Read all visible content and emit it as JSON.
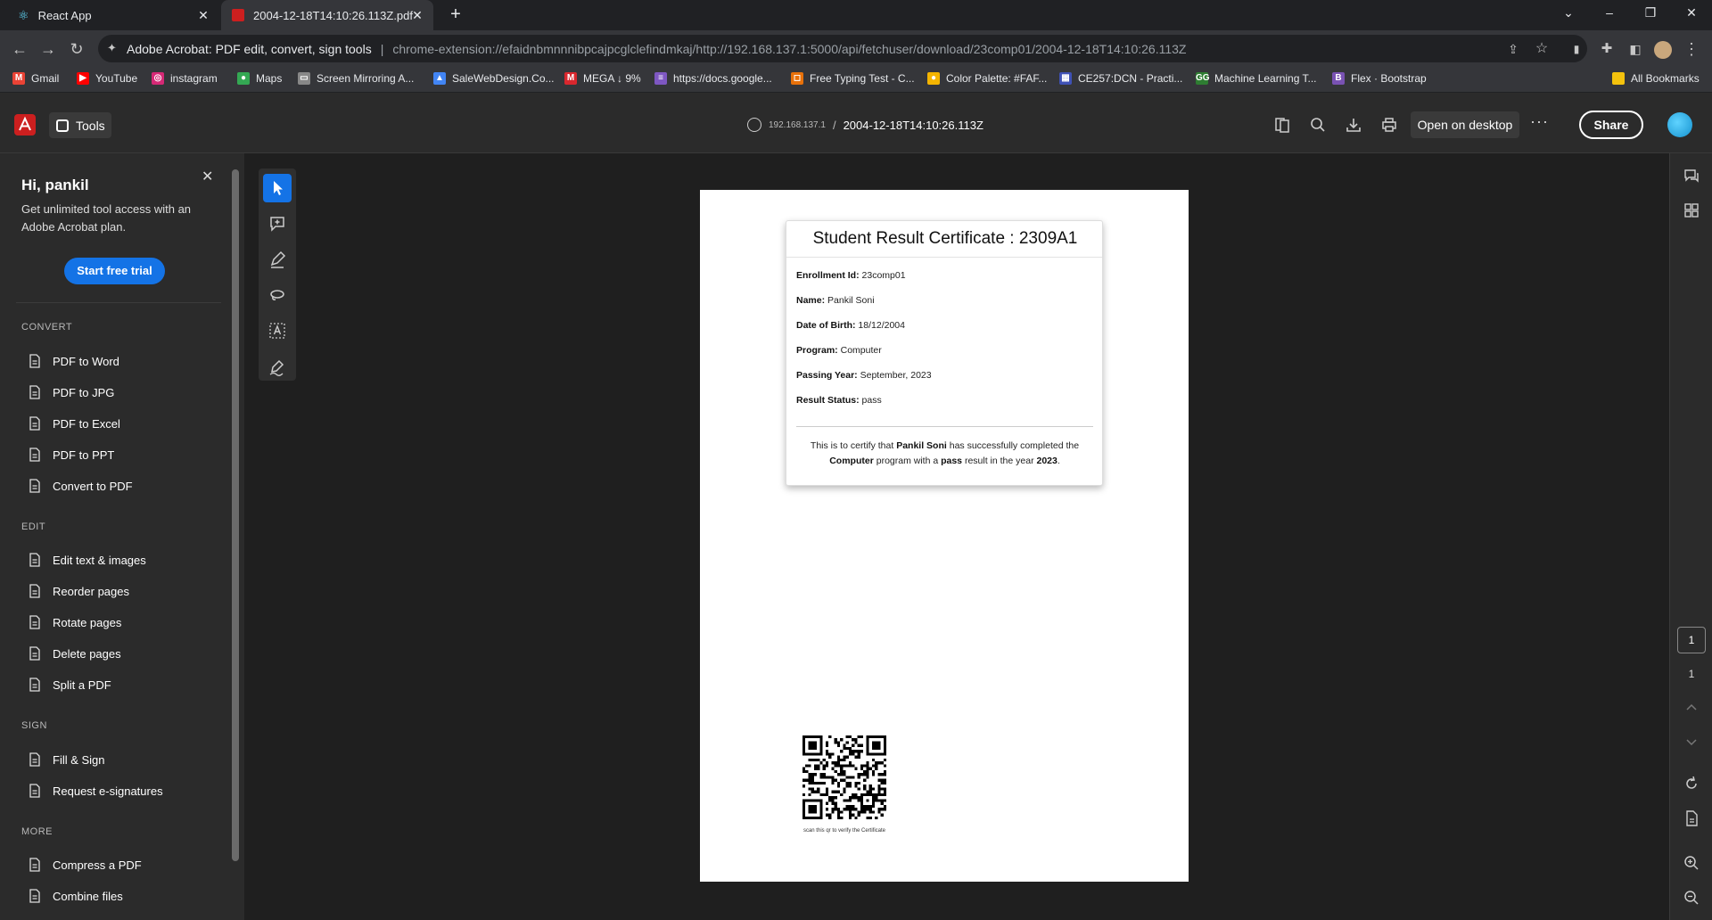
{
  "browser": {
    "tabs": [
      {
        "title": "React App",
        "icon": "react-icon"
      },
      {
        "title": "2004-12-18T14:10:26.113Z.pdf",
        "icon": "pdf-icon"
      }
    ],
    "omnibox": {
      "site_name": "Adobe Acrobat: PDF edit, convert, sign tools",
      "url": "chrome-extension://efaidnbmnnnibpcajpcglclefindmkaj/http://192.168.137.1:5000/api/fetchuser/download/23comp01/2004-12-18T14:10:26.113Z"
    },
    "bookmarks": [
      {
        "label": "Gmail",
        "color": "#ea4335",
        "glyph": "M"
      },
      {
        "label": "YouTube",
        "color": "#ff0000",
        "glyph": "▶"
      },
      {
        "label": "instagram",
        "color": "#d62976",
        "glyph": "◎"
      },
      {
        "label": "Maps",
        "color": "#34a853",
        "glyph": "●"
      },
      {
        "label": "Screen Mirroring A...",
        "color": "#888888",
        "glyph": "▭"
      },
      {
        "label": "SaleWebDesign.Co...",
        "color": "#4285f4",
        "glyph": "▲"
      },
      {
        "label": "MEGA ↓ 9%",
        "color": "#d9272e",
        "glyph": "M"
      },
      {
        "label": "https://docs.google...",
        "color": "#7e57c2",
        "glyph": "≡"
      },
      {
        "label": "Free Typing Test - C...",
        "color": "#e8710a",
        "glyph": "◻"
      },
      {
        "label": "Color Palette: #FAF...",
        "color": "#f4b400",
        "glyph": "●"
      },
      {
        "label": "CE257:DCN - Practi...",
        "color": "#3f51b5",
        "glyph": "▦"
      },
      {
        "label": "Machine Learning T...",
        "color": "#2e7d32",
        "glyph": "GG"
      },
      {
        "label": "Flex · Bootstrap",
        "color": "#7952b3",
        "glyph": "B"
      }
    ],
    "all_bookmarks": "All Bookmarks"
  },
  "acrobat": {
    "tools_label": "Tools",
    "host": "192.168.137.1",
    "filename": "2004-12-18T14:10:26.113Z",
    "open_desktop": "Open on desktop",
    "more": "···",
    "share": "Share"
  },
  "left_panel": {
    "greeting": "Hi, pankil",
    "subtitle": "Get unlimited tool access with an Adobe Acrobat plan.",
    "trial_button": "Start free trial",
    "sections": {
      "convert": "CONVERT",
      "edit": "EDIT",
      "sign": "SIGN",
      "more": "MORE"
    },
    "convert_items": [
      "PDF to Word",
      "PDF to JPG",
      "PDF to Excel",
      "PDF to PPT",
      "Convert to PDF"
    ],
    "edit_items": [
      "Edit text & images",
      "Reorder pages",
      "Rotate pages",
      "Delete pages",
      "Split a PDF"
    ],
    "sign_items": [
      "Fill & Sign",
      "Request e-signatures"
    ],
    "more_items": [
      "Compress a PDF",
      "Combine files"
    ]
  },
  "certificate": {
    "title": "Student Result Certificate : 2309A1",
    "fields": [
      {
        "label": "Enrollment Id:",
        "value": "23comp01"
      },
      {
        "label": "Name:",
        "value": "Pankil Soni"
      },
      {
        "label": "Date of Birth:",
        "value": "18/12/2004"
      },
      {
        "label": "Program:",
        "value": "Computer"
      },
      {
        "label": "Passing Year:",
        "value": "September, 2023"
      },
      {
        "label": "Result Status:",
        "value": "pass"
      }
    ],
    "statement": {
      "p1": "This is to certify that ",
      "name": "Pankil Soni",
      "p2": " has successfully completed the ",
      "program": "Computer",
      "p3": " program with a ",
      "result": "pass",
      "p4": " result in the year ",
      "year": "2023",
      "p5": "."
    },
    "qr_caption": "scan this qr to verify the Certificate"
  },
  "pagination": {
    "current": "1",
    "total": "1"
  },
  "colors": {
    "accent": "#1473e6",
    "acrobat_red": "#cc1f1f"
  }
}
